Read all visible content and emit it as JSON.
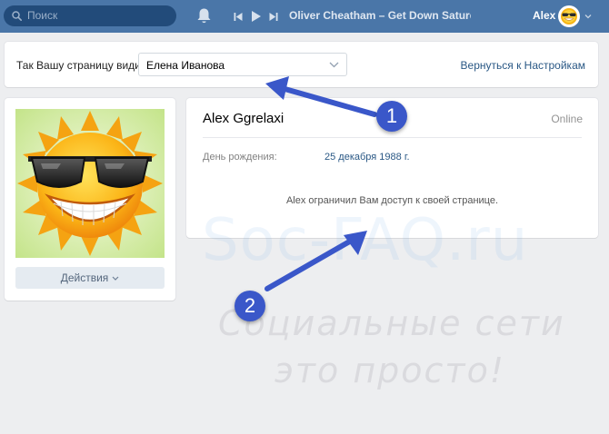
{
  "topbar": {
    "search_placeholder": "Поиск",
    "track": "Oliver Cheatham – Get Down Saturd...",
    "user_name": "Alex"
  },
  "viewbar": {
    "label": "Так Вашу страницу видит",
    "selected_user": "Елена Иванова",
    "back_link": "Вернуться к Настройкам"
  },
  "profile": {
    "actions_label": "Действия",
    "name": "Alex Ggrelaxi",
    "status": "Online",
    "birthday_label": "День рождения:",
    "birthday_value": "25 декабря 1988 г.",
    "restriction_text": "Alex ограничил Вам доступ к своей странице."
  },
  "watermark": {
    "site": "Soc-FAQ.ru",
    "line1": "Социальные сети",
    "line2": "это просто!"
  },
  "annotations": {
    "badge1": "1",
    "badge2": "2"
  },
  "colors": {
    "topbar": "#4a76a8",
    "link": "#2a5885",
    "background": "#edeef0",
    "annotation": "#3a57c9"
  }
}
